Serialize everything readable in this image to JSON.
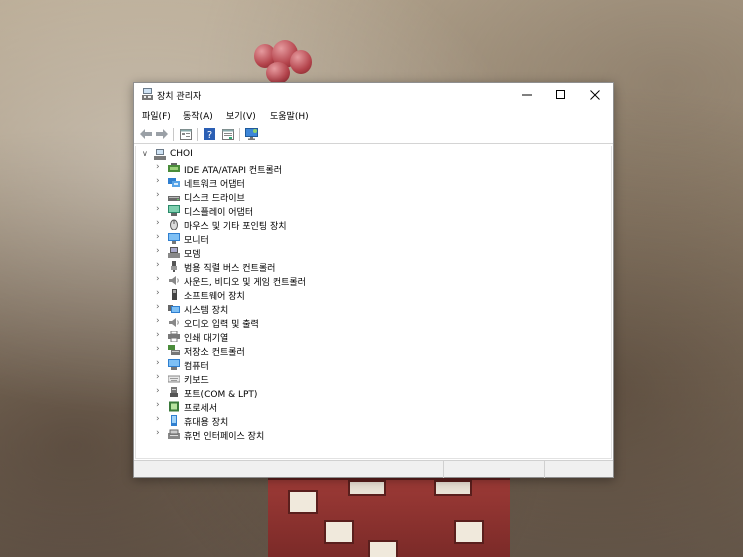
{
  "window": {
    "title": "장치 관리자",
    "controls": [
      "minimize",
      "maximize",
      "close"
    ]
  },
  "menubar": {
    "items": [
      {
        "label": "파일(F)"
      },
      {
        "label": "동작(A)"
      },
      {
        "label": "보기(V)"
      },
      {
        "label": "도움말(H)"
      }
    ]
  },
  "toolbar": {
    "buttons": [
      "back-icon",
      "forward-icon",
      "properties-icon",
      "help-icon",
      "details-icon",
      "scan-hardware-icon"
    ]
  },
  "tree": {
    "root": {
      "label": "CHOI",
      "icon": "computer-icon",
      "expanded": true
    },
    "categories": [
      {
        "label": "IDE ATA/ATAPI 컨트롤러",
        "icon": "ide-controller-icon",
        "color": "#4a8c3a"
      },
      {
        "label": "네트워크 어댑터",
        "icon": "network-adapter-icon",
        "color": "#2f7fd0"
      },
      {
        "label": "디스크 드라이브",
        "icon": "disk-drive-icon",
        "color": "#6a6a6a"
      },
      {
        "label": "디스플레이 어댑터",
        "icon": "display-adapter-icon",
        "color": "#2a8a6a"
      },
      {
        "label": "마우스 및 기타 포인팅 장치",
        "icon": "mouse-icon",
        "color": "#5a5a5a"
      },
      {
        "label": "모니터",
        "icon": "monitor-icon",
        "color": "#2f7fd0"
      },
      {
        "label": "모뎀",
        "icon": "modem-icon",
        "color": "#555555"
      },
      {
        "label": "범용 직렬 버스 컨트롤러",
        "icon": "usb-icon",
        "color": "#555555"
      },
      {
        "label": "사운드, 비디오 및 게임 컨트롤러",
        "icon": "speaker-icon",
        "color": "#777777"
      },
      {
        "label": "소프트웨어 장치",
        "icon": "software-device-icon",
        "color": "#444444"
      },
      {
        "label": "시스템 장치",
        "icon": "system-device-icon",
        "color": "#2f7fd0"
      },
      {
        "label": "오디오 입력 및 출력",
        "icon": "audio-icon",
        "color": "#777777"
      },
      {
        "label": "인쇄 대기열",
        "icon": "printer-icon",
        "color": "#666666"
      },
      {
        "label": "저장소 컨트롤러",
        "icon": "storage-controller-icon",
        "color": "#4a8c3a"
      },
      {
        "label": "컴퓨터",
        "icon": "computer-icon",
        "color": "#2f7fd0"
      },
      {
        "label": "키보드",
        "icon": "keyboard-icon",
        "color": "#888888"
      },
      {
        "label": "포트(COM & LPT)",
        "icon": "port-icon",
        "color": "#555555"
      },
      {
        "label": "프로세서",
        "icon": "processor-icon",
        "color": "#3a7a3a"
      },
      {
        "label": "휴대용 장치",
        "icon": "portable-device-icon",
        "color": "#2f7fd0"
      },
      {
        "label": "휴먼 인터페이스 장치",
        "icon": "hid-icon",
        "color": "#666666"
      }
    ]
  }
}
